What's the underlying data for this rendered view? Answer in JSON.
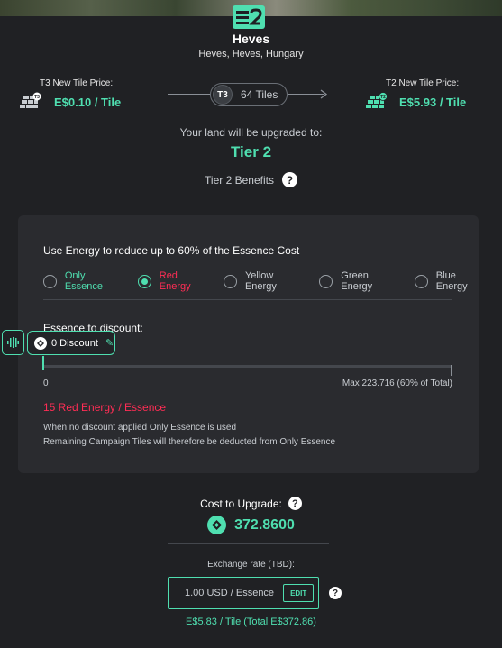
{
  "header": {
    "city": "Heves",
    "region": "Heves, Heves, Hungary"
  },
  "prices": {
    "left": {
      "label": "T3 New Tile Price:",
      "value": "E$0.10 / Tile",
      "badge": "T3",
      "icon": "tile-stack-icon"
    },
    "right": {
      "label": "T2 New Tile Price:",
      "value": "E$5.93 / Tile",
      "badge": "T2",
      "icon": "tile-stack-icon"
    }
  },
  "tier_pill": {
    "badge": "T3",
    "tiles": "64 Tiles"
  },
  "upgrade": {
    "subtitle": "Your land will be upgraded to:",
    "tier": "Tier 2",
    "benefits": "Tier 2 Benefits",
    "help_icon": "?"
  },
  "discount": {
    "intro": "Use Energy to reduce up to 60% of the Essence Cost",
    "options": [
      {
        "label": "Only Essence",
        "selected": false,
        "color": "#4fdfb0"
      },
      {
        "label": "Red Energy",
        "selected": true,
        "color": "#ff2d55"
      },
      {
        "label": "Yellow Energy",
        "selected": false,
        "color": "#c9cdd2"
      },
      {
        "label": "Green Energy",
        "selected": false,
        "color": "#c9cdd2"
      },
      {
        "label": "Blue Energy",
        "selected": false,
        "color": "#c9cdd2"
      }
    ],
    "label": "Essence to discount:",
    "chip": "0 Discount",
    "slider": {
      "value": 0
    },
    "min_label": "0",
    "max_label": "Max 223.716 (60% of Total)",
    "rate": "15 Red Energy / Essence",
    "note_1": "When no discount applied Only Essence is used",
    "note_2": "Remaining Campaign Tiles will therefore be deducted from Only Essence"
  },
  "cost": {
    "label": "Cost to Upgrade:",
    "value": "372.8600",
    "help_icon": "?"
  },
  "exchange": {
    "label": "Exchange rate (TBD):",
    "value": "1.00 USD / Essence",
    "edit": "EDIT",
    "help_icon": "?",
    "total": "E$5.83 / Tile (Total E$372.86)"
  },
  "colors": {
    "accent": "#4fdfb0",
    "red_energy": "#ff2d55",
    "background": "#202124",
    "panel": "#2a2b2f"
  }
}
